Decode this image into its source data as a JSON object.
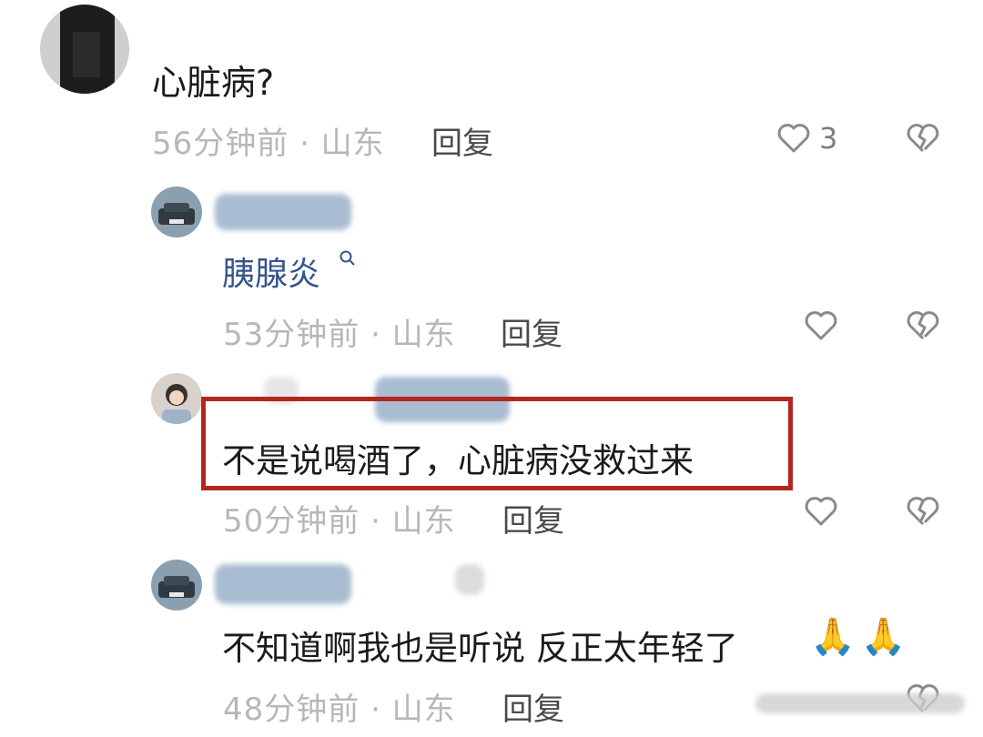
{
  "comments": [
    {
      "text": "心脏病?",
      "meta": "56分钟前 · 山东",
      "reply_label": "回复",
      "like_count": "3"
    },
    {
      "text": "胰腺炎",
      "meta": "53分钟前 · 山东",
      "reply_label": "回复"
    },
    {
      "text": "不是说喝酒了，心脏病没救过来",
      "meta": "50分钟前 · 山东",
      "reply_label": "回复"
    },
    {
      "text": "不知道啊我也是听说 反正太年轻了",
      "emoji": "🙏🙏",
      "meta": "48分钟前 · 山东",
      "reply_label": "回复"
    }
  ],
  "icons": {
    "like": "heart-outline-icon",
    "dislike": "broken-heart-icon",
    "search": "search-icon"
  },
  "colors": {
    "highlight_box": "#b3261e",
    "link_text": "#35558a",
    "meta_text": "#b7b7b7"
  }
}
